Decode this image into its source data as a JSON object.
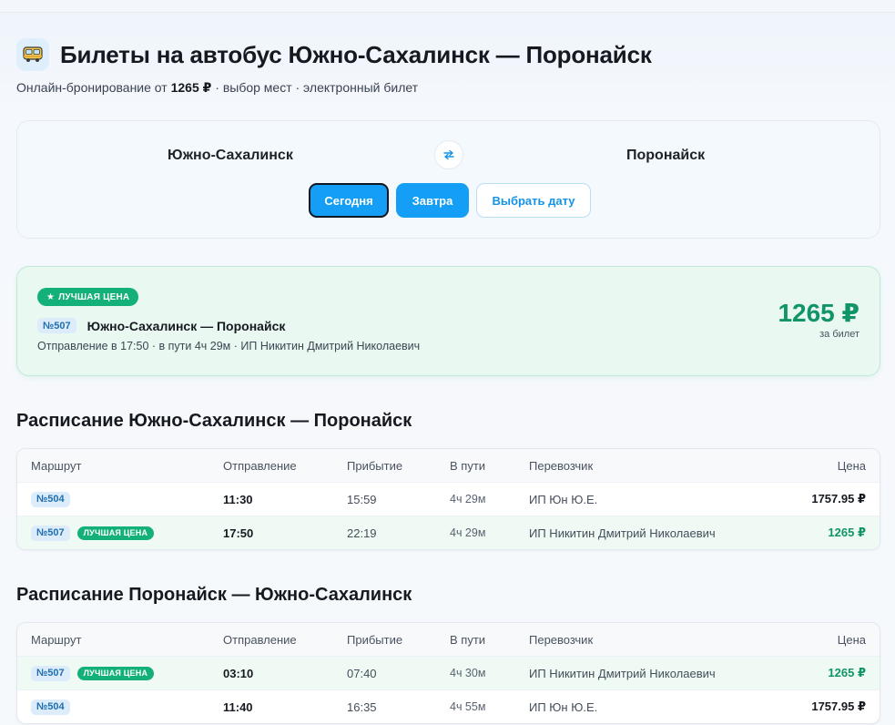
{
  "header": {
    "title": "Билеты на автобус Южно-Сахалинск — Поронайск",
    "subtitle_prefix": "Онлайн-бронирование от ",
    "subtitle_price": "1265 ₽",
    "subtitle_suffix": " · выбор мест · электронный билет",
    "icon": "bus-icon"
  },
  "search": {
    "from_city": "Южно-Сахалинск",
    "to_city": "Поронайск",
    "swap_icon": "swap-arrows-icon",
    "buttons": {
      "today": "Сегодня",
      "tomorrow": "Завтра",
      "pick_date": "Выбрать дату"
    },
    "selected": "today"
  },
  "best_offer": {
    "tag": "ЛУЧШАЯ ЦЕНА",
    "tag_icon": "★",
    "route_number": "№507",
    "route_name": "Южно-Сахалинск — Поронайск",
    "meta": "Отправление в 17:50 · в пути 4ч 29м · ИП Никитин Дмитрий Николаевич",
    "price": "1265 ₽",
    "price_unit": "за билет"
  },
  "columns": {
    "route": "Маршрут",
    "departure": "Отправление",
    "arrival": "Прибытие",
    "duration": "В пути",
    "carrier": "Перевозчик",
    "price": "Цена"
  },
  "schedule_forward": {
    "title": "Расписание Южно-Сахалинск — Поронайск",
    "rows": [
      {
        "number": "№504",
        "tag": "",
        "departure": "11:30",
        "arrival": "15:59",
        "duration": "4ч 29м",
        "carrier": "ИП Юн Ю.Е.",
        "price": "1757.95 ₽"
      },
      {
        "number": "№507",
        "tag": "ЛУЧШАЯ ЦЕНА",
        "departure": "17:50",
        "arrival": "22:19",
        "duration": "4ч 29м",
        "carrier": "ИП Никитин Дмитрий Николаевич",
        "price": "1265 ₽"
      }
    ]
  },
  "schedule_back": {
    "title": "Расписание Поронайск — Южно-Сахалинск",
    "rows": [
      {
        "number": "№507",
        "tag": "ЛУЧШАЯ ЦЕНА",
        "departure": "03:10",
        "arrival": "07:40",
        "duration": "4ч 30м",
        "carrier": "ИП Никитин Дмитрий Николаевич",
        "price": "1265 ₽"
      },
      {
        "number": "№504",
        "tag": "",
        "departure": "11:40",
        "arrival": "16:35",
        "duration": "4ч 55м",
        "carrier": "ИП Юн Ю.Е.",
        "price": "1757.95 ₽"
      }
    ]
  },
  "colors": {
    "accent": "#149ef5",
    "best": "#14b07a",
    "best_price": "#119468"
  }
}
